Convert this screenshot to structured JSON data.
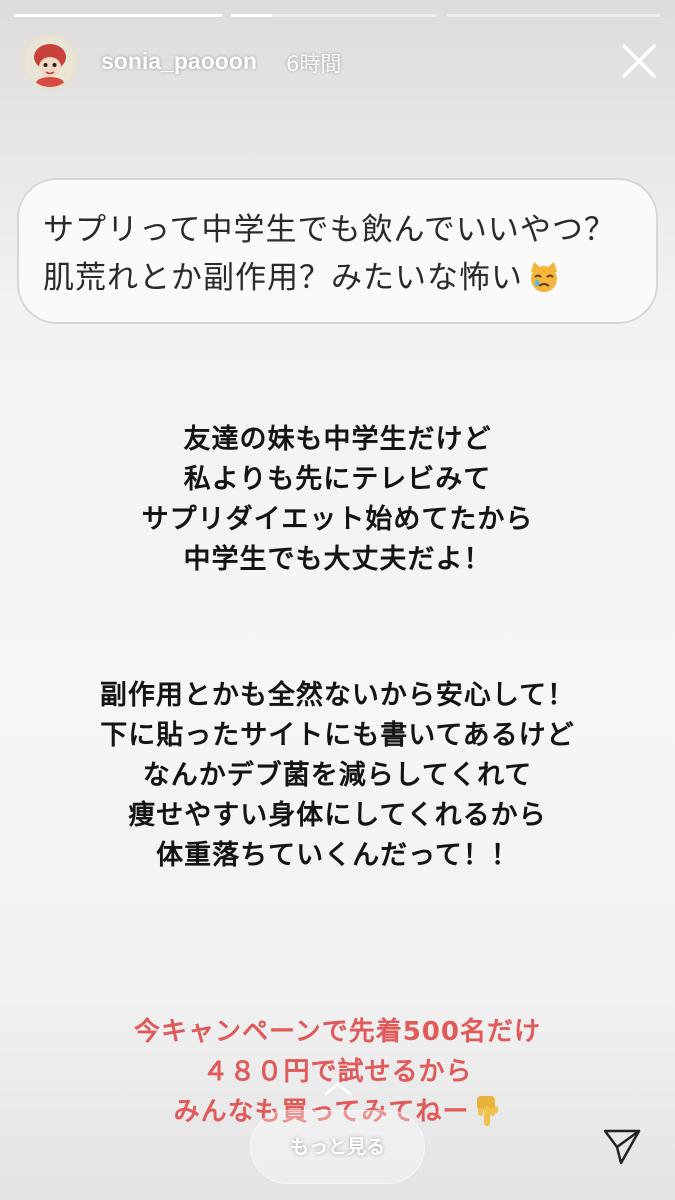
{
  "story": {
    "progress_segments": [
      {
        "fill": 1.0
      },
      {
        "fill": 0.2
      },
      {
        "fill": 0.0
      }
    ]
  },
  "header": {
    "username": "sonia_paooon",
    "timestamp": "6時間",
    "avatar_icon": "cartoon-character-avatar",
    "close_icon": "close-icon"
  },
  "question": {
    "line1": "サプリって中学生でも飲んでいいやつ？",
    "line2": "肌荒れとか副作用？みたいな怖い",
    "emoji": "crying-cat-emoji"
  },
  "body": {
    "paragraph1": [
      "友達の妹も中学生だけど",
      "私よりも先にテレビみて",
      "サプリダイエット始めてたから",
      "中学生でも大丈夫だよ！"
    ],
    "paragraph2": [
      "副作用とかも全然ないから安心して！",
      "下に貼ったサイトにも書いてあるけど",
      "なんかデブ菌を減らしてくれて",
      "痩せやすい身体にしてくれるから",
      "体重落ちていくんだって！！"
    ],
    "campaign": [
      "今キャンペーンで先着500名だけ",
      "４８０円で試せるから",
      "みんなも買ってみてねー"
    ],
    "campaign_emoji": "pointing-down-hand-emoji",
    "campaign_color": "#e05a5a"
  },
  "footer": {
    "more_label": "もっと見る",
    "chevron_icon": "chevron-up-icon",
    "send_icon": "send-icon"
  }
}
